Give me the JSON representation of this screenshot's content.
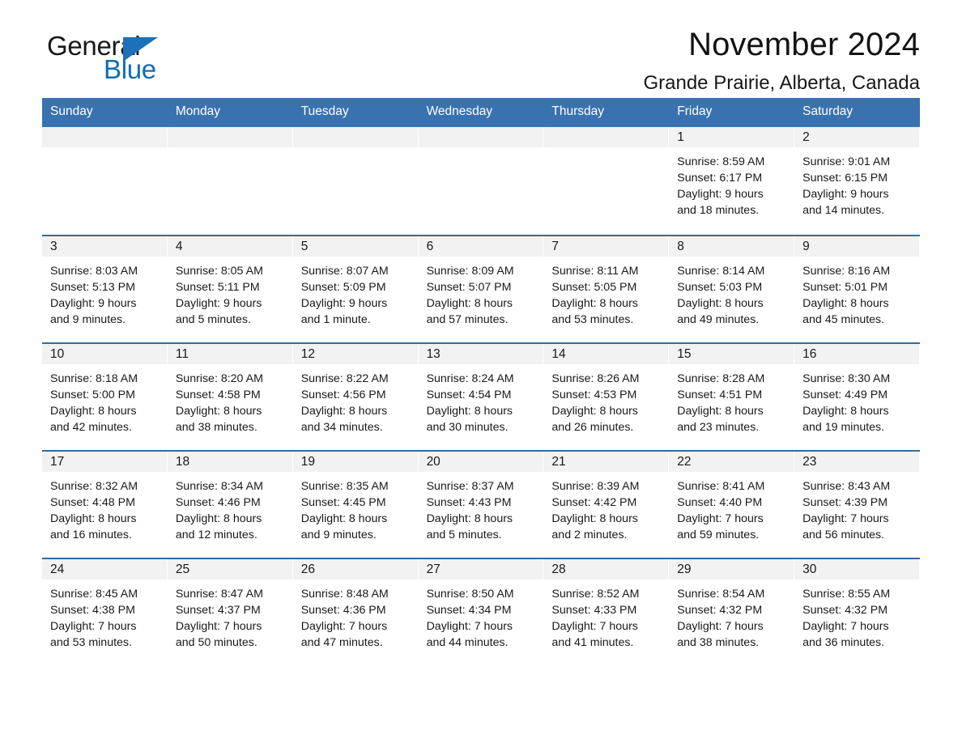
{
  "brand": {
    "name_part1": "General",
    "name_part2": "Blue",
    "accent_color": "#1c71b8"
  },
  "header": {
    "title": "November 2024",
    "subtitle": "Grande Prairie, Alberta, Canada"
  },
  "theme": {
    "header_blue": "#3a72b0",
    "row_rule_blue": "#2f6bab",
    "day_band_gray": "#f2f2f2"
  },
  "weekdays": [
    "Sunday",
    "Monday",
    "Tuesday",
    "Wednesday",
    "Thursday",
    "Friday",
    "Saturday"
  ],
  "weeks": [
    [
      {
        "date": "",
        "sunrise": "",
        "sunset": "",
        "daylight1": "",
        "daylight2": "",
        "empty": true
      },
      {
        "date": "",
        "sunrise": "",
        "sunset": "",
        "daylight1": "",
        "daylight2": "",
        "empty": true
      },
      {
        "date": "",
        "sunrise": "",
        "sunset": "",
        "daylight1": "",
        "daylight2": "",
        "empty": true
      },
      {
        "date": "",
        "sunrise": "",
        "sunset": "",
        "daylight1": "",
        "daylight2": "",
        "empty": true
      },
      {
        "date": "",
        "sunrise": "",
        "sunset": "",
        "daylight1": "",
        "daylight2": "",
        "empty": true
      },
      {
        "date": "1",
        "sunrise": "Sunrise: 8:59 AM",
        "sunset": "Sunset: 6:17 PM",
        "daylight1": "Daylight: 9 hours",
        "daylight2": "and 18 minutes."
      },
      {
        "date": "2",
        "sunrise": "Sunrise: 9:01 AM",
        "sunset": "Sunset: 6:15 PM",
        "daylight1": "Daylight: 9 hours",
        "daylight2": "and 14 minutes."
      }
    ],
    [
      {
        "date": "3",
        "sunrise": "Sunrise: 8:03 AM",
        "sunset": "Sunset: 5:13 PM",
        "daylight1": "Daylight: 9 hours",
        "daylight2": "and 9 minutes."
      },
      {
        "date": "4",
        "sunrise": "Sunrise: 8:05 AM",
        "sunset": "Sunset: 5:11 PM",
        "daylight1": "Daylight: 9 hours",
        "daylight2": "and 5 minutes."
      },
      {
        "date": "5",
        "sunrise": "Sunrise: 8:07 AM",
        "sunset": "Sunset: 5:09 PM",
        "daylight1": "Daylight: 9 hours",
        "daylight2": "and 1 minute."
      },
      {
        "date": "6",
        "sunrise": "Sunrise: 8:09 AM",
        "sunset": "Sunset: 5:07 PM",
        "daylight1": "Daylight: 8 hours",
        "daylight2": "and 57 minutes."
      },
      {
        "date": "7",
        "sunrise": "Sunrise: 8:11 AM",
        "sunset": "Sunset: 5:05 PM",
        "daylight1": "Daylight: 8 hours",
        "daylight2": "and 53 minutes."
      },
      {
        "date": "8",
        "sunrise": "Sunrise: 8:14 AM",
        "sunset": "Sunset: 5:03 PM",
        "daylight1": "Daylight: 8 hours",
        "daylight2": "and 49 minutes."
      },
      {
        "date": "9",
        "sunrise": "Sunrise: 8:16 AM",
        "sunset": "Sunset: 5:01 PM",
        "daylight1": "Daylight: 8 hours",
        "daylight2": "and 45 minutes."
      }
    ],
    [
      {
        "date": "10",
        "sunrise": "Sunrise: 8:18 AM",
        "sunset": "Sunset: 5:00 PM",
        "daylight1": "Daylight: 8 hours",
        "daylight2": "and 42 minutes."
      },
      {
        "date": "11",
        "sunrise": "Sunrise: 8:20 AM",
        "sunset": "Sunset: 4:58 PM",
        "daylight1": "Daylight: 8 hours",
        "daylight2": "and 38 minutes."
      },
      {
        "date": "12",
        "sunrise": "Sunrise: 8:22 AM",
        "sunset": "Sunset: 4:56 PM",
        "daylight1": "Daylight: 8 hours",
        "daylight2": "and 34 minutes."
      },
      {
        "date": "13",
        "sunrise": "Sunrise: 8:24 AM",
        "sunset": "Sunset: 4:54 PM",
        "daylight1": "Daylight: 8 hours",
        "daylight2": "and 30 minutes."
      },
      {
        "date": "14",
        "sunrise": "Sunrise: 8:26 AM",
        "sunset": "Sunset: 4:53 PM",
        "daylight1": "Daylight: 8 hours",
        "daylight2": "and 26 minutes."
      },
      {
        "date": "15",
        "sunrise": "Sunrise: 8:28 AM",
        "sunset": "Sunset: 4:51 PM",
        "daylight1": "Daylight: 8 hours",
        "daylight2": "and 23 minutes."
      },
      {
        "date": "16",
        "sunrise": "Sunrise: 8:30 AM",
        "sunset": "Sunset: 4:49 PM",
        "daylight1": "Daylight: 8 hours",
        "daylight2": "and 19 minutes."
      }
    ],
    [
      {
        "date": "17",
        "sunrise": "Sunrise: 8:32 AM",
        "sunset": "Sunset: 4:48 PM",
        "daylight1": "Daylight: 8 hours",
        "daylight2": "and 16 minutes."
      },
      {
        "date": "18",
        "sunrise": "Sunrise: 8:34 AM",
        "sunset": "Sunset: 4:46 PM",
        "daylight1": "Daylight: 8 hours",
        "daylight2": "and 12 minutes."
      },
      {
        "date": "19",
        "sunrise": "Sunrise: 8:35 AM",
        "sunset": "Sunset: 4:45 PM",
        "daylight1": "Daylight: 8 hours",
        "daylight2": "and 9 minutes."
      },
      {
        "date": "20",
        "sunrise": "Sunrise: 8:37 AM",
        "sunset": "Sunset: 4:43 PM",
        "daylight1": "Daylight: 8 hours",
        "daylight2": "and 5 minutes."
      },
      {
        "date": "21",
        "sunrise": "Sunrise: 8:39 AM",
        "sunset": "Sunset: 4:42 PM",
        "daylight1": "Daylight: 8 hours",
        "daylight2": "and 2 minutes."
      },
      {
        "date": "22",
        "sunrise": "Sunrise: 8:41 AM",
        "sunset": "Sunset: 4:40 PM",
        "daylight1": "Daylight: 7 hours",
        "daylight2": "and 59 minutes."
      },
      {
        "date": "23",
        "sunrise": "Sunrise: 8:43 AM",
        "sunset": "Sunset: 4:39 PM",
        "daylight1": "Daylight: 7 hours",
        "daylight2": "and 56 minutes."
      }
    ],
    [
      {
        "date": "24",
        "sunrise": "Sunrise: 8:45 AM",
        "sunset": "Sunset: 4:38 PM",
        "daylight1": "Daylight: 7 hours",
        "daylight2": "and 53 minutes."
      },
      {
        "date": "25",
        "sunrise": "Sunrise: 8:47 AM",
        "sunset": "Sunset: 4:37 PM",
        "daylight1": "Daylight: 7 hours",
        "daylight2": "and 50 minutes."
      },
      {
        "date": "26",
        "sunrise": "Sunrise: 8:48 AM",
        "sunset": "Sunset: 4:36 PM",
        "daylight1": "Daylight: 7 hours",
        "daylight2": "and 47 minutes."
      },
      {
        "date": "27",
        "sunrise": "Sunrise: 8:50 AM",
        "sunset": "Sunset: 4:34 PM",
        "daylight1": "Daylight: 7 hours",
        "daylight2": "and 44 minutes."
      },
      {
        "date": "28",
        "sunrise": "Sunrise: 8:52 AM",
        "sunset": "Sunset: 4:33 PM",
        "daylight1": "Daylight: 7 hours",
        "daylight2": "and 41 minutes."
      },
      {
        "date": "29",
        "sunrise": "Sunrise: 8:54 AM",
        "sunset": "Sunset: 4:32 PM",
        "daylight1": "Daylight: 7 hours",
        "daylight2": "and 38 minutes."
      },
      {
        "date": "30",
        "sunrise": "Sunrise: 8:55 AM",
        "sunset": "Sunset: 4:32 PM",
        "daylight1": "Daylight: 7 hours",
        "daylight2": "and 36 minutes."
      }
    ]
  ]
}
